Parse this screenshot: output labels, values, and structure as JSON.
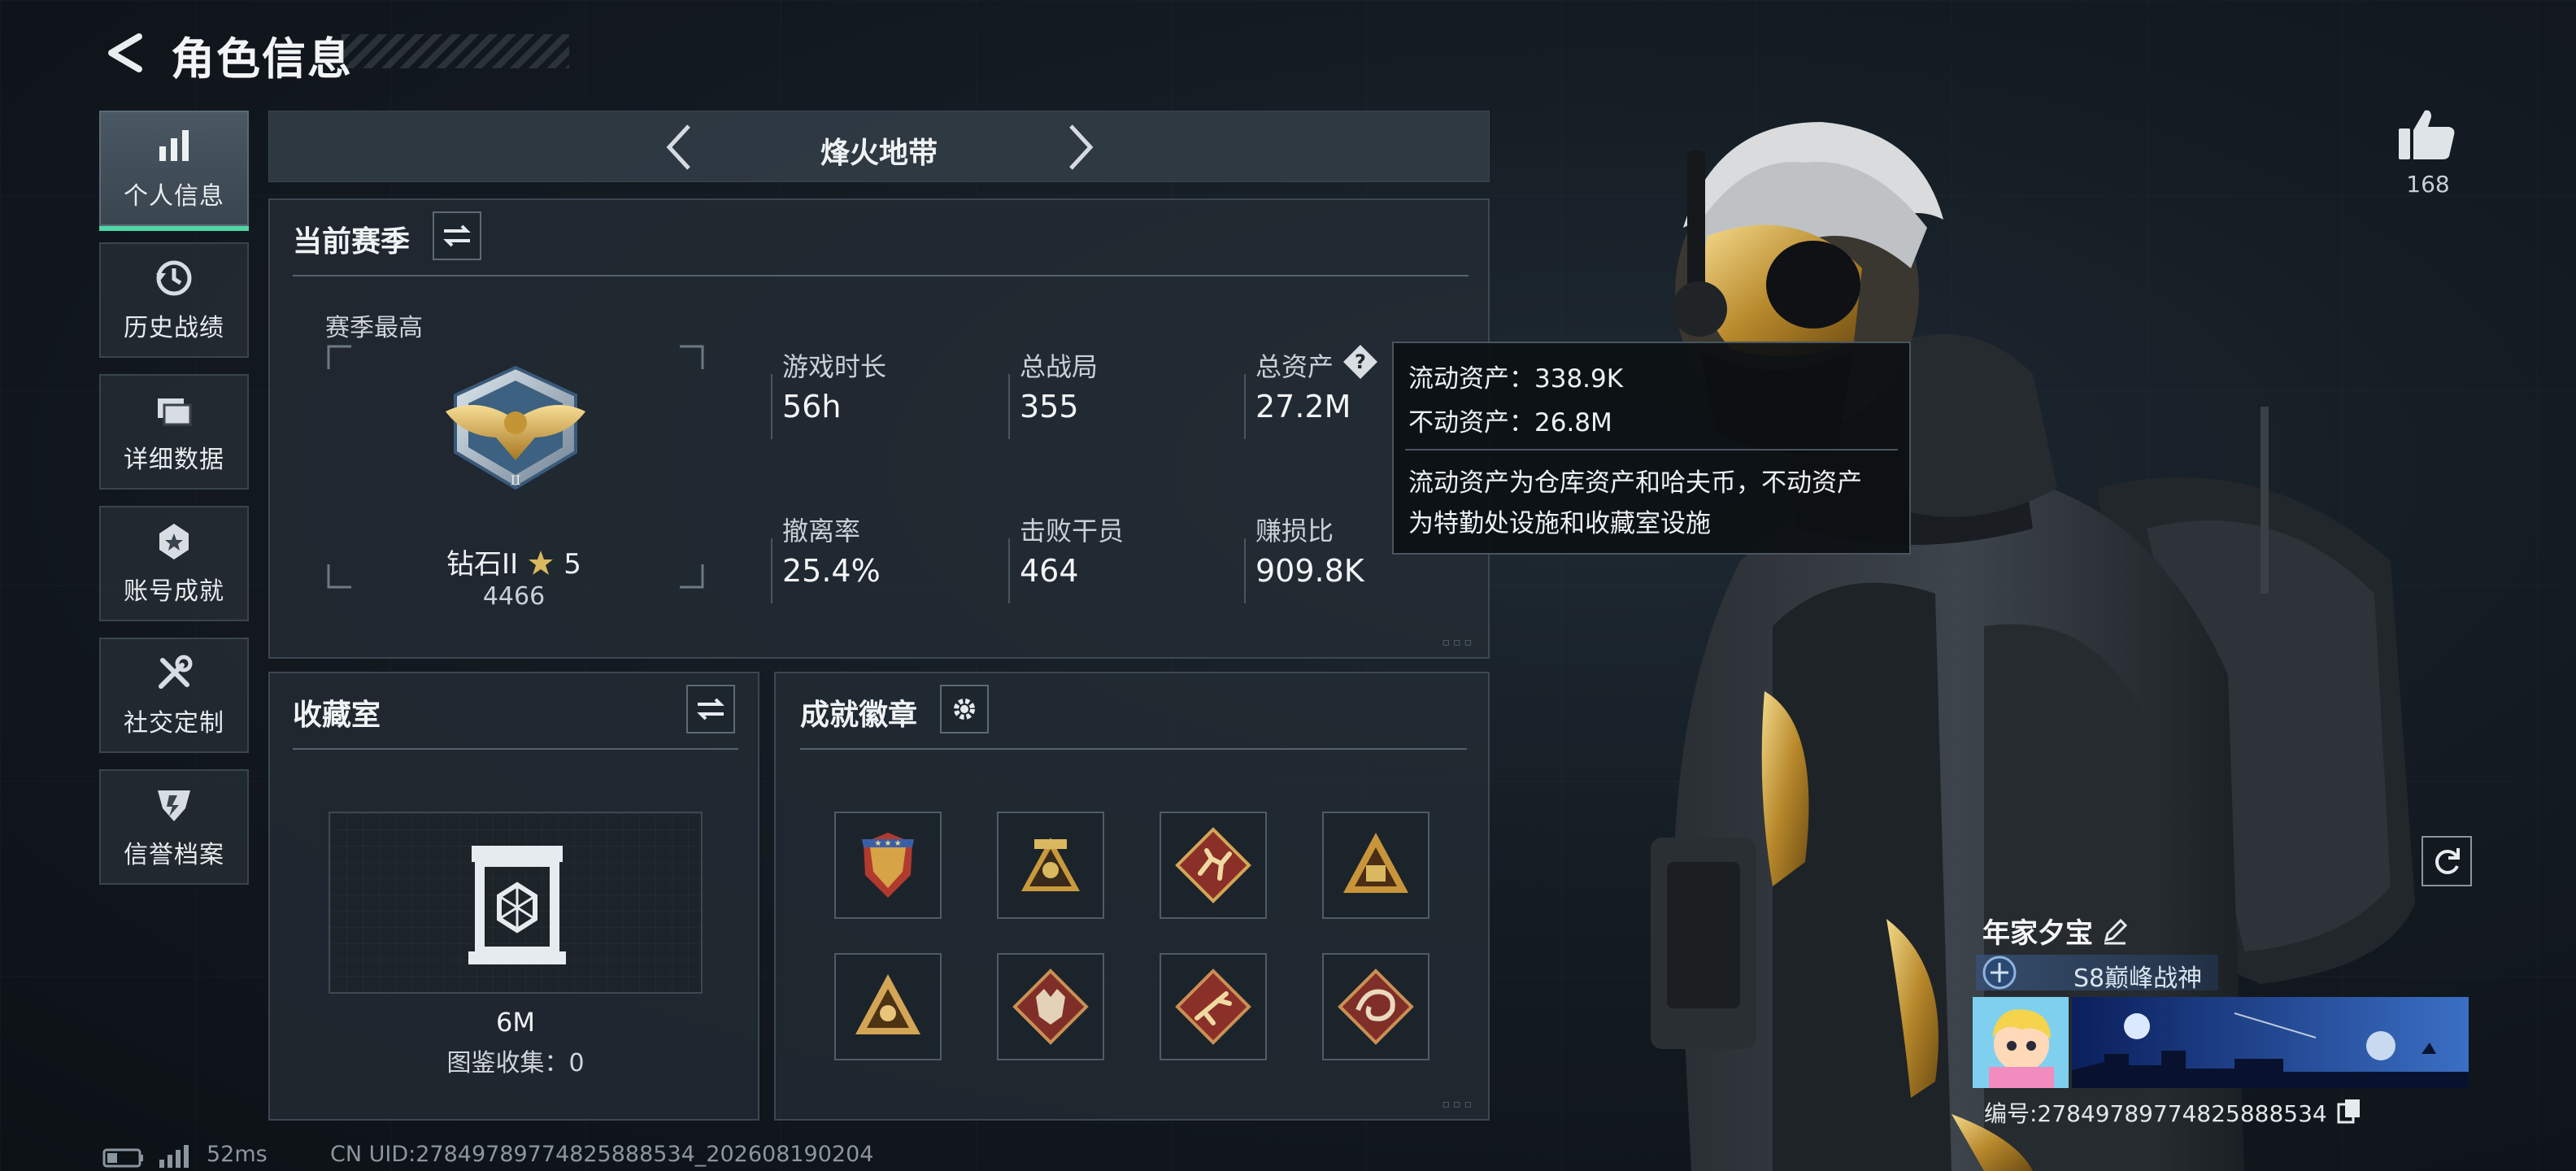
{
  "header": {
    "title": "角色信息"
  },
  "nav": {
    "items": [
      {
        "label": "个人信息",
        "icon": "bar-chart-icon",
        "active": true
      },
      {
        "label": "历史战绩",
        "icon": "history-clock-icon",
        "active": false
      },
      {
        "label": "详细数据",
        "icon": "folder-icon",
        "active": false
      },
      {
        "label": "账号成就",
        "icon": "achievement-star-icon",
        "active": false
      },
      {
        "label": "社交定制",
        "icon": "tools-icon",
        "active": false
      },
      {
        "label": "信誉档案",
        "icon": "shield-icon",
        "active": false
      }
    ]
  },
  "mode": {
    "title": "烽火地带"
  },
  "season": {
    "title": "当前赛季",
    "best_label": "赛季最高",
    "rank_name": "钻石II",
    "rank_stars": "5",
    "rank_points": "4466",
    "stats": [
      {
        "label": "游戏时长",
        "value": "56h"
      },
      {
        "label": "总战局",
        "value": "355"
      },
      {
        "label": "总资产",
        "value": "27.2M"
      },
      {
        "label": "撤离率",
        "value": "25.4%"
      },
      {
        "label": "击败干员",
        "value": "464"
      },
      {
        "label": "赚损比",
        "value": "909.8K"
      }
    ]
  },
  "tooltip": {
    "liquid": "流动资产：338.9K",
    "fixed": "不动资产：26.8M",
    "desc_line1": "流动资产为仓库资产和哈夫币，不动资产",
    "desc_line2": "为特勤处设施和收藏室设施"
  },
  "collection": {
    "title": "收藏室",
    "value": "6M",
    "catalog": "图鉴收集：0"
  },
  "badges": {
    "title": "成就徽章",
    "items": [
      "eagle-badge-icon",
      "helmet-badge-icon",
      "runner-badge-icon",
      "triangle-badge-icon",
      "eye-badge-icon",
      "wolf-badge-icon",
      "gun-badge-icon",
      "dragon-badge-icon"
    ]
  },
  "likes": {
    "count": "168"
  },
  "player": {
    "name": "年家夕宝",
    "title": "S8巅峰战神",
    "id": "编号:2784978977482588853​4"
  },
  "footer": {
    "ping": "52ms",
    "uid": "CN UID:2784978977482588853​4_202608190204"
  },
  "colors": {
    "accent": "#4fd6a6",
    "gold": "#c9a44a",
    "panel": "#242c34"
  }
}
